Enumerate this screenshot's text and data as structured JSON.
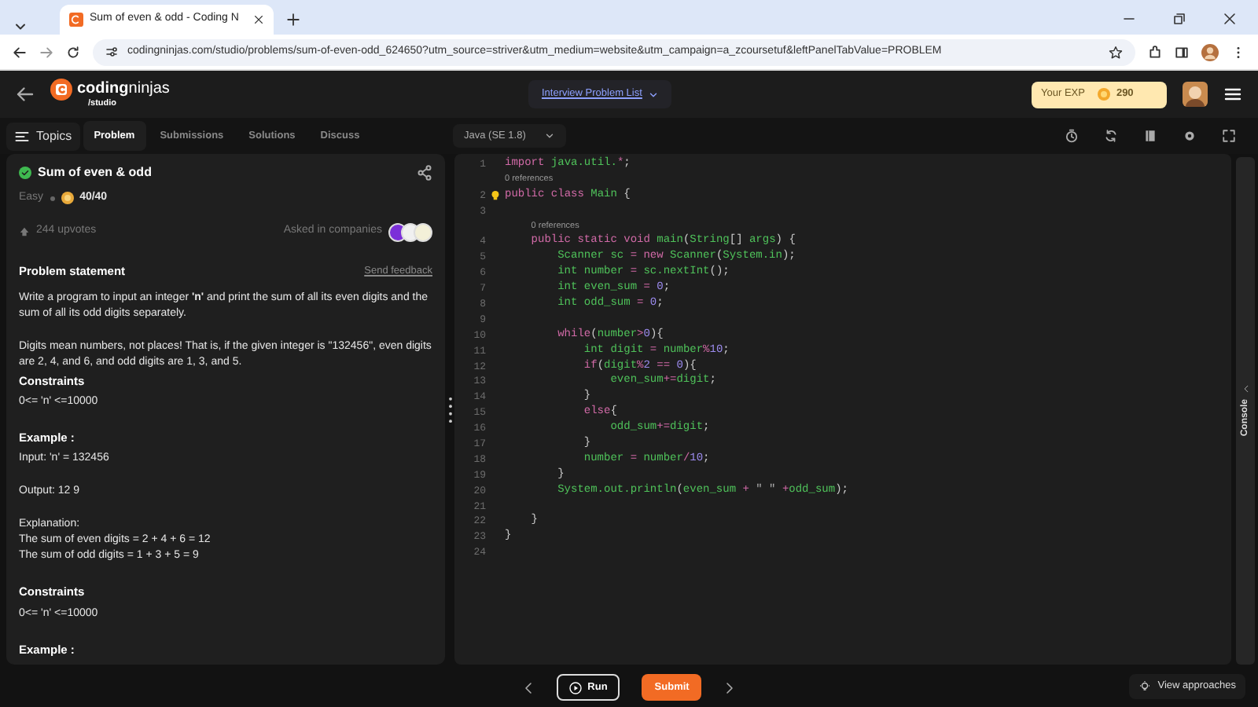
{
  "browser": {
    "tab_title": "Sum of even & odd - Coding N",
    "url": "codingninjas.com/studio/problems/sum-of-even-odd_624650?utm_source=striver&utm_medium=website&utm_campaign=a_zcoursetuf&leftPanelTabValue=PROBLEM"
  },
  "header": {
    "logo_bold": "coding",
    "logo_light": "ninjas",
    "logo_sub": "/studio",
    "problem_list": "Interview Problem List",
    "exp_label": "Your EXP",
    "exp_value": "290"
  },
  "topics_button": "Topics",
  "left_tabs": [
    {
      "label": "Problem",
      "selected": true
    },
    {
      "label": "Submissions",
      "selected": false
    },
    {
      "label": "Solutions",
      "selected": false
    },
    {
      "label": "Discuss",
      "selected": false
    }
  ],
  "problem": {
    "title": "Sum of even & odd",
    "solved": true,
    "difficulty": "Easy",
    "score": "40/40",
    "upvotes": "244 upvotes",
    "companies_label": "Asked in companies",
    "statement_heading": "Problem statement",
    "feedback": "Send feedback",
    "content": [
      {
        "kind": "text",
        "text": "Write a program to input an integer **'n'** and print the sum of all its even digits and the sum of all its odd digits separately."
      },
      {
        "kind": "gap"
      },
      {
        "kind": "text",
        "text": "Digits mean numbers, not places! That is, if the given integer is \"132456\", even digits are 2, 4, and 6, and odd digits are 1, 3, and 5."
      },
      {
        "kind": "heading",
        "text": "Constraints"
      },
      {
        "kind": "text",
        "text": "0<= 'n' <=10000"
      },
      {
        "kind": "gap"
      },
      {
        "kind": "heading",
        "text": "Example :"
      },
      {
        "kind": "text",
        "text": "Input: 'n' = 132456"
      },
      {
        "kind": "gap"
      },
      {
        "kind": "text",
        "text": "Output: 12 9"
      },
      {
        "kind": "gap"
      },
      {
        "kind": "text",
        "text": "Explanation:"
      },
      {
        "kind": "text",
        "text": "The sum of even digits = 2 + 4 + 6 = 12"
      },
      {
        "kind": "text",
        "text": "The sum of odd digits = 1 + 3 + 5 = 9"
      },
      {
        "kind": "gap"
      },
      {
        "kind": "heading",
        "text": "Constraints"
      },
      {
        "kind": "text",
        "text": "0<= 'n' <=10000"
      },
      {
        "kind": "gap"
      },
      {
        "kind": "heading",
        "text": "Example :"
      }
    ]
  },
  "editor": {
    "language": "Java (SE 1.8)",
    "console": "Console",
    "lines": [
      {
        "kind": "code",
        "number": "1",
        "tokens": [
          {
            "kind": "keyword",
            "text": "import"
          },
          {
            "kind": "ident",
            "text": " java.util."
          },
          {
            "kind": "operator",
            "text": "*"
          },
          {
            "kind": "punct",
            "text": ";"
          }
        ]
      },
      {
        "kind": "codelens",
        "indented": false,
        "text": "0 references"
      },
      {
        "kind": "code",
        "number": "2",
        "tokens": [
          {
            "kind": "keyword",
            "text": "public"
          },
          {
            "kind": "keyword",
            "text": " class"
          },
          {
            "kind": "ident",
            "text": " Main"
          },
          {
            "kind": "punct",
            "text": " {"
          }
        ]
      },
      {
        "kind": "code",
        "number": "3"
      },
      {
        "kind": "codelens",
        "indented": true,
        "text": "0 references"
      },
      {
        "kind": "code",
        "number": "4",
        "tokens": [
          {
            "kind": "keyword",
            "text": "    public"
          },
          {
            "kind": "keyword",
            "text": " static"
          },
          {
            "kind": "keyword",
            "text": " void"
          },
          {
            "kind": "ident",
            "text": " main"
          },
          {
            "kind": "punct",
            "text": "("
          },
          {
            "kind": "ident",
            "text": "String"
          },
          {
            "kind": "punct",
            "text": "[]"
          },
          {
            "kind": "ident",
            "text": " args"
          },
          {
            "kind": "punct",
            "text": ") {"
          }
        ]
      },
      {
        "kind": "code",
        "number": "5",
        "tokens": [
          {
            "kind": "ident",
            "text": "        Scanner"
          },
          {
            "kind": "ident",
            "text": " sc"
          },
          {
            "kind": "operator",
            "text": " ="
          },
          {
            "kind": "keyword",
            "text": " new"
          },
          {
            "kind": "ident",
            "text": " Scanner"
          },
          {
            "kind": "punct",
            "text": "("
          },
          {
            "kind": "ident",
            "text": "System.in"
          },
          {
            "kind": "punct",
            "text": ");"
          }
        ]
      },
      {
        "kind": "code",
        "number": "6",
        "tokens": [
          {
            "kind": "ident",
            "text": "        int"
          },
          {
            "kind": "ident",
            "text": " number"
          },
          {
            "kind": "operator",
            "text": " ="
          },
          {
            "kind": "ident",
            "text": " sc.nextInt"
          },
          {
            "kind": "punct",
            "text": "();"
          }
        ]
      },
      {
        "kind": "code",
        "number": "7",
        "tokens": [
          {
            "kind": "ident",
            "text": "        int"
          },
          {
            "kind": "ident",
            "text": " even_sum"
          },
          {
            "kind": "operator",
            "text": " ="
          },
          {
            "kind": "number",
            "text": " 0"
          },
          {
            "kind": "punct",
            "text": ";"
          }
        ]
      },
      {
        "kind": "code",
        "number": "8",
        "tokens": [
          {
            "kind": "ident",
            "text": "        int"
          },
          {
            "kind": "ident",
            "text": " odd_sum"
          },
          {
            "kind": "operator",
            "text": " ="
          },
          {
            "kind": "number",
            "text": " 0"
          },
          {
            "kind": "punct",
            "text": ";"
          }
        ]
      },
      {
        "kind": "code",
        "number": "9"
      },
      {
        "kind": "code",
        "number": "10",
        "tokens": [
          {
            "kind": "keyword",
            "text": "        while"
          },
          {
            "kind": "punct",
            "text": "("
          },
          {
            "kind": "ident",
            "text": "number"
          },
          {
            "kind": "operator",
            "text": ">"
          },
          {
            "kind": "number",
            "text": "0"
          },
          {
            "kind": "punct",
            "text": "){"
          }
        ]
      },
      {
        "kind": "code",
        "number": "11",
        "tokens": [
          {
            "kind": "ident",
            "text": "            int"
          },
          {
            "kind": "ident",
            "text": " digit"
          },
          {
            "kind": "operator",
            "text": " ="
          },
          {
            "kind": "ident",
            "text": " number"
          },
          {
            "kind": "operator",
            "text": "%"
          },
          {
            "kind": "number",
            "text": "10"
          },
          {
            "kind": "punct",
            "text": ";"
          }
        ]
      },
      {
        "kind": "code",
        "number": "12",
        "tokens": [
          {
            "kind": "keyword",
            "text": "            if"
          },
          {
            "kind": "punct",
            "text": "("
          },
          {
            "kind": "ident",
            "text": "digit"
          },
          {
            "kind": "operator",
            "text": "%"
          },
          {
            "kind": "number",
            "text": "2"
          },
          {
            "kind": "operator",
            "text": " =="
          },
          {
            "kind": "number",
            "text": " 0"
          },
          {
            "kind": "punct",
            "text": "){"
          }
        ]
      },
      {
        "kind": "code",
        "number": "13",
        "tokens": [
          {
            "kind": "ident",
            "text": "                even_sum"
          },
          {
            "kind": "operator",
            "text": "+="
          },
          {
            "kind": "ident",
            "text": "digit"
          },
          {
            "kind": "punct",
            "text": ";"
          }
        ]
      },
      {
        "kind": "code",
        "number": "14",
        "tokens": [
          {
            "kind": "punct",
            "text": "            }"
          }
        ]
      },
      {
        "kind": "code",
        "number": "15",
        "tokens": [
          {
            "kind": "keyword",
            "text": "            else"
          },
          {
            "kind": "punct",
            "text": "{"
          }
        ]
      },
      {
        "kind": "code",
        "number": "16",
        "tokens": [
          {
            "kind": "ident",
            "text": "                odd_sum"
          },
          {
            "kind": "operator",
            "text": "+="
          },
          {
            "kind": "ident",
            "text": "digit"
          },
          {
            "kind": "punct",
            "text": ";"
          }
        ]
      },
      {
        "kind": "code",
        "number": "17",
        "tokens": [
          {
            "kind": "punct",
            "text": "            }"
          }
        ]
      },
      {
        "kind": "code",
        "number": "18",
        "tokens": [
          {
            "kind": "ident",
            "text": "            number"
          },
          {
            "kind": "operator",
            "text": " ="
          },
          {
            "kind": "ident",
            "text": " number"
          },
          {
            "kind": "operator",
            "text": "/"
          },
          {
            "kind": "number",
            "text": "10"
          },
          {
            "kind": "punct",
            "text": ";"
          }
        ]
      },
      {
        "kind": "code",
        "number": "19",
        "tokens": [
          {
            "kind": "punct",
            "text": "        }"
          }
        ]
      },
      {
        "kind": "code",
        "number": "20",
        "tokens": [
          {
            "kind": "ident",
            "text": "        System.out.println"
          },
          {
            "kind": "punct",
            "text": "("
          },
          {
            "kind": "ident",
            "text": "even_sum"
          },
          {
            "kind": "operator",
            "text": " +"
          },
          {
            "kind": "string",
            "text": " \" \""
          },
          {
            "kind": "operator",
            "text": " +"
          },
          {
            "kind": "ident",
            "text": "odd_sum"
          },
          {
            "kind": "punct",
            "text": ");"
          }
        ]
      },
      {
        "kind": "code",
        "number": "21"
      },
      {
        "kind": "code",
        "number": "22",
        "tokens": [
          {
            "kind": "punct",
            "text": "    }"
          }
        ]
      },
      {
        "kind": "code",
        "number": "23",
        "tokens": [
          {
            "kind": "punct",
            "text": "}"
          }
        ]
      },
      {
        "kind": "code",
        "number": "24"
      }
    ]
  },
  "footer": {
    "run": "Run",
    "submit": "Submit",
    "approaches": "View approaches"
  }
}
